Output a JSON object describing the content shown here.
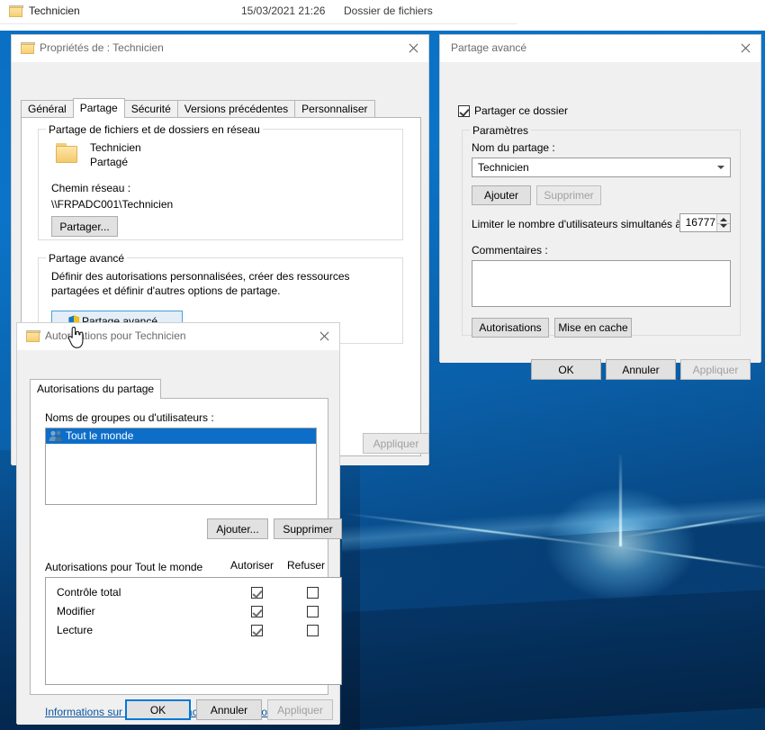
{
  "explorer_row": {
    "icon": "folder-icon",
    "name": "Technicien",
    "date": "15/03/2021 21:26",
    "type": "Dossier de fichiers"
  },
  "properties_dialog": {
    "title": "Propriétés de : Technicien",
    "icon": "folder-icon",
    "close_icon": "close-icon",
    "tabs": [
      {
        "label": "Général",
        "active": false
      },
      {
        "label": "Partage",
        "active": true
      },
      {
        "label": "Sécurité",
        "active": false
      },
      {
        "label": "Versions précédentes",
        "active": false
      },
      {
        "label": "Personnaliser",
        "active": false
      }
    ],
    "network_group": {
      "legend": "Partage de fichiers et de dossiers en réseau",
      "folder_icon": "folder-icon",
      "folder_name": "Technicien",
      "share_state": "Partagé",
      "path_label": "Chemin réseau :",
      "path_value": "\\\\FRPADC001\\Technicien",
      "share_button": "Partager..."
    },
    "advanced_group": {
      "legend": "Partage avancé",
      "description": "Définir des autorisations personnalisées, créer des ressources partagées et définir d'autres options de partage.",
      "button": "Partage avancé...",
      "button_icon": "shield-icon"
    },
    "apply_button": "Appliquer"
  },
  "advanced_sharing_dialog": {
    "title": "Partage avancé",
    "close_icon": "close-icon",
    "share_checkbox": {
      "label": "Partager ce dossier",
      "checked": true
    },
    "settings_group": {
      "legend": "Paramètres",
      "share_name_label": "Nom du partage :",
      "share_name_value": "Technicien",
      "share_name_dropdown_icon": "chevron-down-icon",
      "add_button": "Ajouter",
      "remove_button": "Supprimer",
      "remove_button_disabled": true,
      "limit_label": "Limiter le nombre d'utilisateurs simultanés à :",
      "limit_value": "16777",
      "comments_label": "Commentaires :",
      "comments_value": "",
      "permissions_button": "Autorisations",
      "caching_button": "Mise en cache"
    },
    "ok_button": "OK",
    "cancel_button": "Annuler",
    "apply_button": "Appliquer",
    "apply_disabled": true
  },
  "permissions_dialog": {
    "title": "Autorisations pour Technicien",
    "icon": "folder-icon",
    "close_icon": "close-icon",
    "tabs": [
      {
        "label": "Autorisations du partage",
        "active": true
      }
    ],
    "group_names_label": "Noms de groupes ou d'utilisateurs :",
    "group_list": [
      {
        "name": "Tout le monde",
        "icon": "users-icon",
        "selected": true
      }
    ],
    "add_button": "Ajouter...",
    "remove_button": "Supprimer",
    "perm_for_label": "Autorisations pour Tout le monde",
    "col_allow": "Autoriser",
    "col_deny": "Refuser",
    "permissions": [
      {
        "name": "Contrôle total",
        "allow": true,
        "deny": false
      },
      {
        "name": "Modifier",
        "allow": true,
        "deny": false
      },
      {
        "name": "Lecture",
        "allow": true,
        "deny": false
      }
    ],
    "info_link": "Informations sur le contrôle d'accès et les autorisations",
    "ok_button": "OK",
    "cancel_button": "Annuler",
    "apply_button": "Appliquer",
    "apply_disabled": true
  },
  "colors": {
    "accent": "#0078d7",
    "selection": "#0d6ec9",
    "link": "#0b55a2",
    "dialog_bg": "#f0f0f0",
    "desktop": "#0a6fc2"
  },
  "cursor": {
    "type": "hand-pointer-cursor"
  }
}
